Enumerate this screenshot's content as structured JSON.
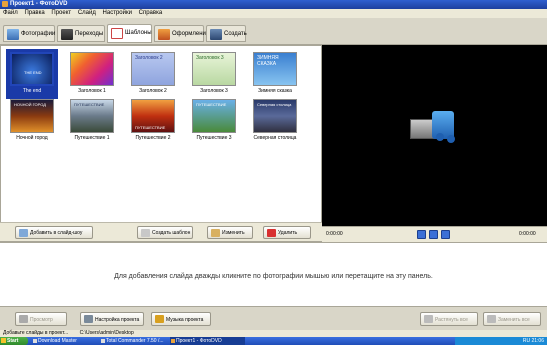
{
  "window": {
    "title": "Проект1 - ФотоDVD"
  },
  "menu": [
    "Файл",
    "Правка",
    "Проект",
    "Слайд",
    "Настройки",
    "Справка"
  ],
  "tabs": [
    {
      "label": "Фотографии",
      "icon": "photos-icon",
      "active": false
    },
    {
      "label": "Переходы",
      "icon": "transitions-icon",
      "active": false
    },
    {
      "label": "Шаблоны",
      "icon": "templates-icon",
      "active": true
    },
    {
      "label": "Оформление",
      "icon": "design-icon",
      "active": false
    },
    {
      "label": "Создать",
      "icon": "create-icon",
      "active": false
    }
  ],
  "templates": [
    {
      "caption": "The end",
      "image_text": "THE END",
      "selected": true
    },
    {
      "caption": "Заголовок 1",
      "image_text": ""
    },
    {
      "caption": "Заголовок 2",
      "image_text": "Заголовок 2"
    },
    {
      "caption": "Заголовок 3",
      "image_text": "Заголовок 3"
    },
    {
      "caption": "Зимняя сказка",
      "image_text": "ЗИМНЯЯ СКАЗКА"
    },
    {
      "caption": "Ночной город",
      "image_text": "НОЧНОЙ ГОРОД"
    },
    {
      "caption": "Путешествие 1",
      "image_text": "ПУТЕШЕСТВИЕ"
    },
    {
      "caption": "Путешествие 2",
      "image_text": "ПУТЕШЕСТВИЕ"
    },
    {
      "caption": "Путешествие 3",
      "image_text": "ПУТЕШЕСТВИЕ"
    },
    {
      "caption": "Северная столица",
      "image_text": "Северная столица"
    }
  ],
  "template_buttons": {
    "add": "Добавить в слайд-шоу",
    "create": "Создать шаблон",
    "edit": "Изменить",
    "delete": "Удалить"
  },
  "player": {
    "time_start": "0:00:00",
    "time_end": "0:00:00"
  },
  "dropzone": {
    "message": "Для добавления слайда дважды кликните по фотографии мышью или перетащите на эту панель."
  },
  "bottom_buttons": {
    "preview": "Просмотр",
    "project_settings": "Настройка проекта",
    "project_music": "Музыка проекта",
    "stretch": "Растянуть все",
    "replace": "Заменить все"
  },
  "status": {
    "hint": "Добавьте слайды в проект...",
    "path": "C:\\Users\\admin\\Desktop"
  },
  "taskbar": {
    "start": "Start",
    "tasks": [
      "Download Master",
      "Total Commander 7.50 /...",
      "Проект1 - ФотоDVD"
    ],
    "tray": "RU 21:06"
  },
  "colors": {
    "title_blue": "#1d3f9e",
    "window_bg": "#ece9d8",
    "selection_blue": "#1a3aa8",
    "preview_bg": "#000000"
  }
}
